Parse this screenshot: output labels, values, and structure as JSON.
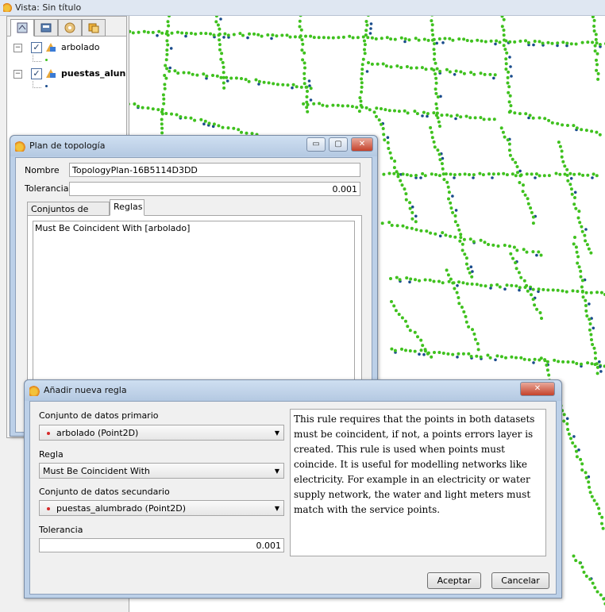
{
  "main_window": {
    "title": "Vista: Sin título"
  },
  "toc": {
    "tabs": [
      {
        "icon": "layers-tab-icon"
      },
      {
        "icon": "catalog-tab-icon"
      },
      {
        "icon": "settings-tab-icon"
      },
      {
        "icon": "extra-tab-icon"
      }
    ],
    "layers": [
      {
        "label": "arbolado",
        "checked": true
      },
      {
        "label": "puestas_alun",
        "checked": true
      }
    ]
  },
  "map": {
    "primary_color": "#3fc11e",
    "secondary_color": "#1a4c8c"
  },
  "topology_dialog": {
    "title": "Plan de topología",
    "name_label": "Nombre",
    "name_value": "TopologyPlan-16B5114D3DD",
    "tolerance_label": "Tolerancia",
    "tolerance_value": "0.001",
    "tabs": [
      "Conjuntos de datos",
      "Reglas"
    ],
    "active_tab": "Reglas",
    "rules": [
      "Must Be Coincident With [arbolado]"
    ],
    "buttons": {
      "minimize": "▭",
      "maximize": "▢",
      "close": "✕"
    }
  },
  "rule_dialog": {
    "title": "Añadir nueva regla",
    "primary_label": "Conjunto de datos primario",
    "primary_value": "arbolado (Point2D)",
    "rule_label": "Regla",
    "rule_value": "Must Be Coincident With",
    "secondary_label": "Conjunto de datos secundario",
    "secondary_value": "puestas_alumbrado (Point2D)",
    "tolerance_label": "Tolerancia",
    "tolerance_value": "0.001",
    "description": "This rule requires that the points in both datasets must be coincident, if not, a points errors layer is created. This rule is used when points must coincide. It is useful for modelling networks like electricity. For example in an electricity or water supply network, the water and light meters must match with the service points.",
    "accept": "Aceptar",
    "cancel": "Cancelar",
    "close": "✕"
  }
}
